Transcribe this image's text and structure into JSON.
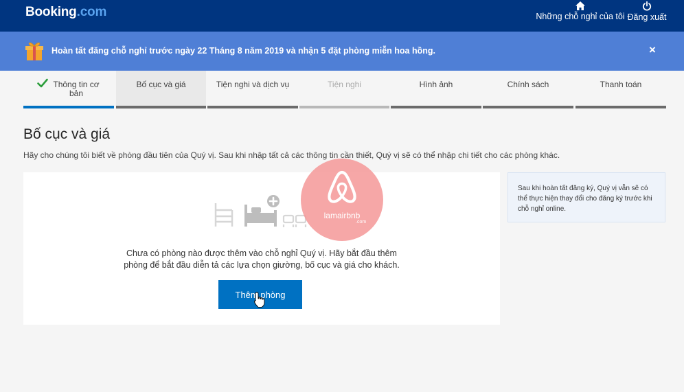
{
  "header": {
    "logo_main": "Booking",
    "logo_suffix": "com",
    "my_properties_label": "Những chỗ nghỉ của tôi",
    "logout_label": "Đăng xuất",
    "icons": {
      "home": "home-icon",
      "power": "power-icon"
    }
  },
  "banner": {
    "message": "Hoàn tất đăng chỗ nghỉ trước ngày 22 Tháng 8 năm 2019 và nhận 5 đặt phòng miễn hoa hồng.",
    "close_label": "×"
  },
  "steps": [
    {
      "label_line1": "Thông tin cơ",
      "label_line2": "bản",
      "state": "done"
    },
    {
      "label_line1": "Bố cục và giá",
      "label_line2": "",
      "state": "active"
    },
    {
      "label_line1": "Tiện nghi và dịch vụ",
      "label_line2": "",
      "state": "todo"
    },
    {
      "label_line1": "Tiện nghi",
      "label_line2": "",
      "state": "disabled"
    },
    {
      "label_line1": "Hình ảnh",
      "label_line2": "",
      "state": "todo"
    },
    {
      "label_line1": "Chính sách",
      "label_line2": "",
      "state": "todo"
    },
    {
      "label_line1": "Thanh toán",
      "label_line2": "",
      "state": "todo"
    }
  ],
  "main": {
    "title": "Bố cục và giá",
    "subtitle": "Hãy cho chúng tôi biết về phòng đầu tiên của Quý vị. Sau khi nhập tất cả các thông tin cần thiết, Quý vị sẽ có thể nhập chi tiết cho các phòng khác.",
    "empty_line1": "Chưa có phòng nào được thêm vào chỗ nghỉ Quý vị. Hãy bắt đầu thêm",
    "empty_line2": "phòng để bắt đầu diễn tả các lựa chọn giường, bố cục và giá cho khách.",
    "add_room_label": "Thêm phòng"
  },
  "sidebar": {
    "tip": "Sau khi hoàn tất đăng ký, Quý vị vẫn sẽ có thể thực hiện thay đổi cho đăng ký trước khi chỗ nghỉ online."
  },
  "watermark": {
    "name": "lamairbnb",
    "suffix": ".com"
  },
  "colors": {
    "header": "#003580",
    "banner": "#4f7fd6",
    "primary": "#0071c2",
    "watermark": "#f49898"
  }
}
